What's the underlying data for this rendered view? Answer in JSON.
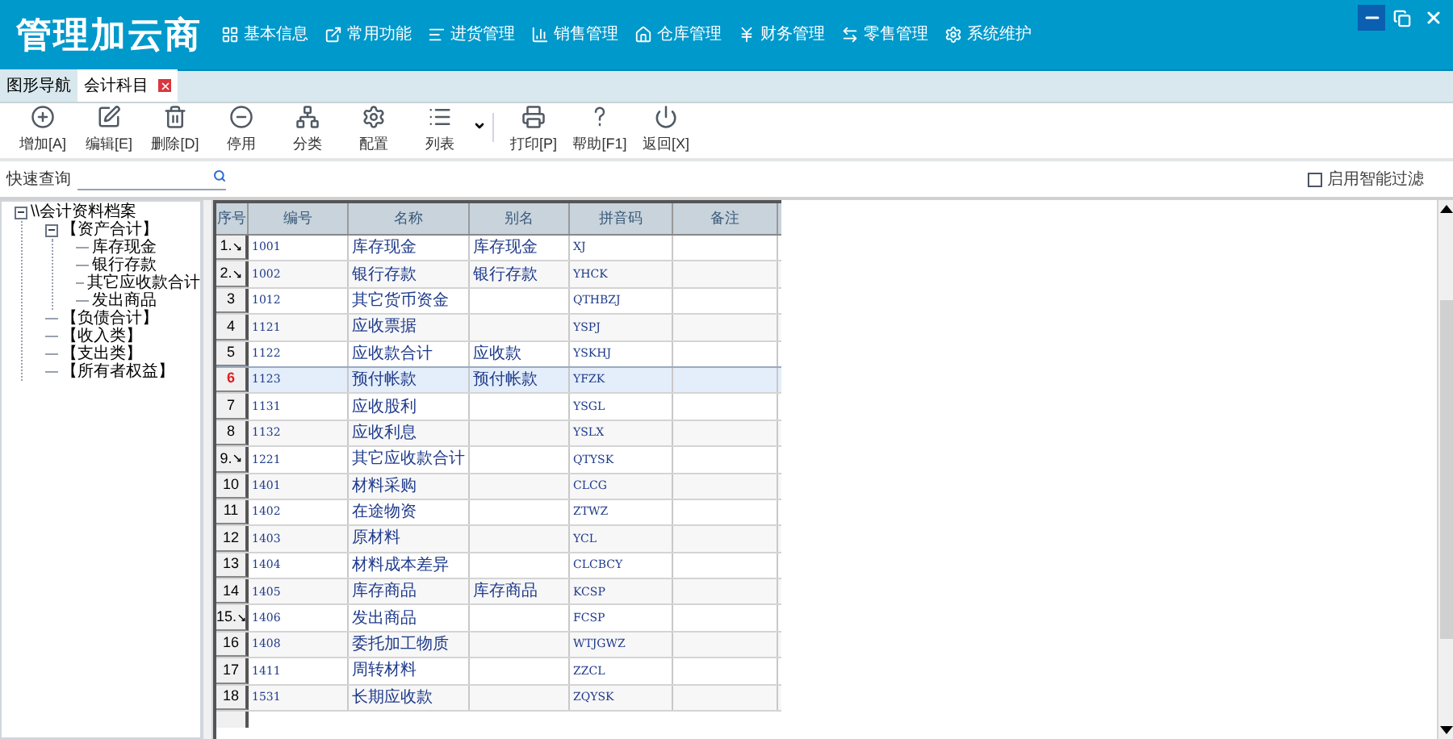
{
  "app": {
    "title": "管理加云商"
  },
  "menu": [
    {
      "label": "基本信息",
      "kind": "grid"
    },
    {
      "label": "常用功能",
      "kind": "external"
    },
    {
      "label": "进货管理",
      "kind": "lines"
    },
    {
      "label": "销售管理",
      "kind": "chart"
    },
    {
      "label": "仓库管理",
      "kind": "home"
    },
    {
      "label": "财务管理",
      "kind": "yen"
    },
    {
      "label": "零售管理",
      "kind": "swap"
    },
    {
      "label": "系统维护",
      "kind": "gear"
    }
  ],
  "tabs": [
    {
      "label": "图形导航",
      "selected": false,
      "closable": false
    },
    {
      "label": "会计科目",
      "selected": true,
      "closable": true
    }
  ],
  "toolbar": [
    {
      "label": "增加[A]",
      "kind": "add"
    },
    {
      "label": "编辑[E]",
      "kind": "edit"
    },
    {
      "label": "删除[D]",
      "kind": "delete"
    },
    {
      "label": "停用",
      "kind": "disable"
    },
    {
      "label": "分类",
      "kind": "category"
    },
    {
      "label": "配置",
      "kind": "config"
    },
    {
      "label": "列表",
      "kind": "list",
      "dropdown": true
    },
    {
      "label": "打印[P]",
      "kind": "print"
    },
    {
      "label": "帮助[F1]",
      "kind": "help"
    },
    {
      "label": "返回[X]",
      "kind": "back"
    }
  ],
  "search": {
    "label": "快速查询"
  },
  "smart_filter": {
    "label": "启用智能过滤",
    "checked": false
  },
  "tree": {
    "label": "\\\\会计资料档案",
    "expanded": true,
    "children": [
      {
        "label": "【资产合计】",
        "expanded": true,
        "children": [
          {
            "label": "库存现金"
          },
          {
            "label": "银行存款"
          },
          {
            "label": "其它应收款合计"
          },
          {
            "label": "发出商品"
          }
        ]
      },
      {
        "label": "【负债合计】"
      },
      {
        "label": "【收入类】"
      },
      {
        "label": "【支出类】"
      },
      {
        "label": "【所有者权益】"
      }
    ]
  },
  "table": {
    "columns": [
      "序号",
      "编号",
      "名称",
      "别名",
      "拼音码",
      "备注"
    ],
    "rows": [
      {
        "has_children": true,
        "selected": false,
        "cells": [
          "1.",
          "1001",
          "库存现金",
          "库存现金",
          "XJ",
          ""
        ]
      },
      {
        "has_children": true,
        "selected": false,
        "cells": [
          "2.",
          "1002",
          "银行存款",
          "银行存款",
          "YHCK",
          ""
        ]
      },
      {
        "has_children": false,
        "selected": false,
        "cells": [
          "3",
          "1012",
          "其它货币资金",
          "",
          "QTHBZJ",
          ""
        ]
      },
      {
        "has_children": false,
        "selected": false,
        "cells": [
          "4",
          "1121",
          "应收票据",
          "",
          "YSPJ",
          ""
        ]
      },
      {
        "has_children": false,
        "selected": false,
        "cells": [
          "5",
          "1122",
          "应收款合计",
          "应收款",
          "YSKHJ",
          ""
        ]
      },
      {
        "has_children": false,
        "selected": true,
        "cells": [
          "6",
          "1123",
          "预付帐款",
          "预付帐款",
          "YFZK",
          ""
        ]
      },
      {
        "has_children": false,
        "selected": false,
        "cells": [
          "7",
          "1131",
          "应收股利",
          "",
          "YSGL",
          ""
        ]
      },
      {
        "has_children": false,
        "selected": false,
        "cells": [
          "8",
          "1132",
          "应收利息",
          "",
          "YSLX",
          ""
        ]
      },
      {
        "has_children": true,
        "selected": false,
        "cells": [
          "9.",
          "1221",
          "其它应收款合计",
          "",
          "QTYSK",
          ""
        ]
      },
      {
        "has_children": false,
        "selected": false,
        "cells": [
          "10",
          "1401",
          "材料采购",
          "",
          "CLCG",
          ""
        ]
      },
      {
        "has_children": false,
        "selected": false,
        "cells": [
          "11",
          "1402",
          "在途物资",
          "",
          "ZTWZ",
          ""
        ]
      },
      {
        "has_children": false,
        "selected": false,
        "cells": [
          "12",
          "1403",
          "原材料",
          "",
          "YCL",
          ""
        ]
      },
      {
        "has_children": false,
        "selected": false,
        "cells": [
          "13",
          "1404",
          "材料成本差异",
          "",
          "CLCBCY",
          ""
        ]
      },
      {
        "has_children": false,
        "selected": false,
        "cells": [
          "14",
          "1405",
          "库存商品",
          "库存商品",
          "KCSP",
          ""
        ]
      },
      {
        "has_children": true,
        "selected": false,
        "cells": [
          "15.",
          "1406",
          "发出商品",
          "",
          "FCSP",
          ""
        ]
      },
      {
        "has_children": false,
        "selected": false,
        "cells": [
          "16",
          "1408",
          "委托加工物质",
          "",
          "WTJGWZ",
          ""
        ]
      },
      {
        "has_children": false,
        "selected": false,
        "cells": [
          "17",
          "1411",
          "周转材料",
          "",
          "ZZCL",
          ""
        ]
      },
      {
        "has_children": false,
        "selected": false,
        "cells": [
          "18",
          "1531",
          "长期应收款",
          "",
          "ZQYSK",
          ""
        ]
      }
    ]
  }
}
